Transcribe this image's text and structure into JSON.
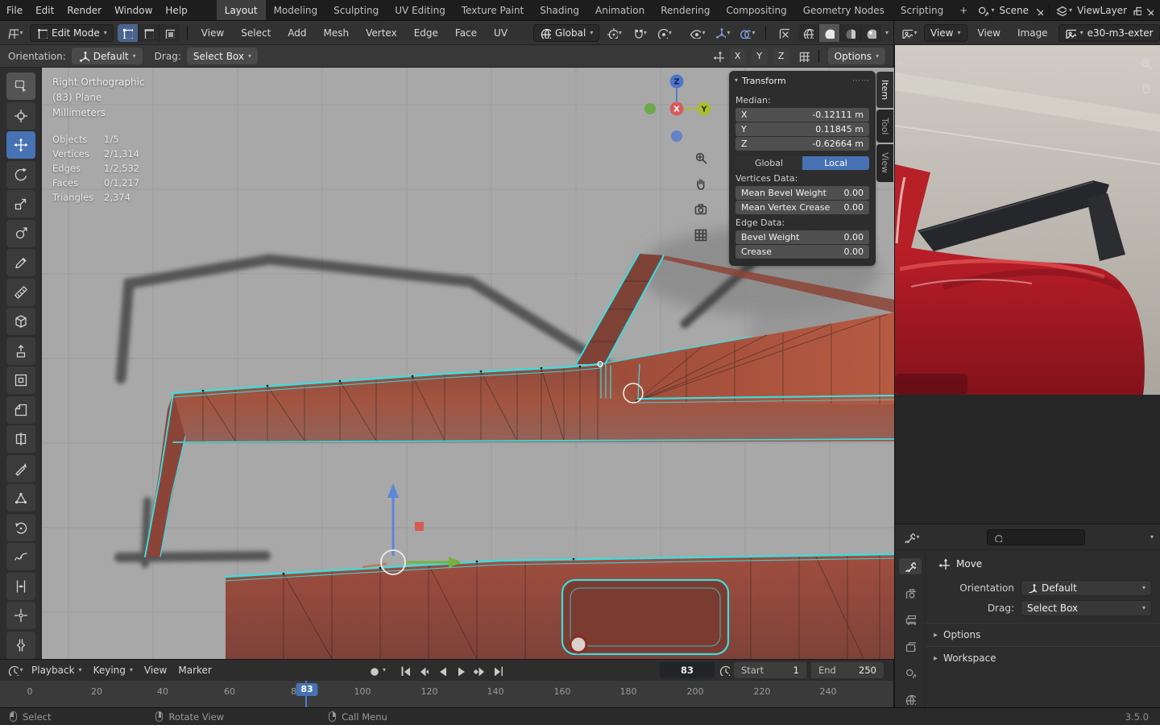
{
  "topbar": {
    "menus": [
      "File",
      "Edit",
      "Render",
      "Window",
      "Help"
    ],
    "workspaces": [
      "Layout",
      "Modeling",
      "Sculpting",
      "UV Editing",
      "Texture Paint",
      "Shading",
      "Animation",
      "Rendering",
      "Compositing",
      "Geometry Nodes",
      "Scripting"
    ],
    "active_workspace": "Layout",
    "add_workspace_label": "+",
    "scene_label": "Scene",
    "viewlayer_label": "ViewLayer"
  },
  "viewport_header": {
    "mode": "Edit Mode",
    "menus": [
      "View",
      "Select",
      "Add",
      "Mesh",
      "Vertex",
      "Edge",
      "Face",
      "UV"
    ],
    "orientation": "Global"
  },
  "img_header": {
    "view_dropdown": "View",
    "menus": [
      "View",
      "Image"
    ],
    "image_name": "e30-m3-exter"
  },
  "tool_settings": {
    "orientation_label": "Orientation:",
    "orientation_value": "Default",
    "drag_label": "Drag:",
    "drag_value": "Select Box",
    "axes": [
      "X",
      "Y",
      "Z"
    ],
    "options_label": "Options"
  },
  "viewport": {
    "view_name": "Right Orthographic",
    "object_name": "(83) Plane",
    "units": "Millimeters",
    "stats": [
      {
        "label": "Objects",
        "value": "1/5"
      },
      {
        "label": "Vertices",
        "value": "2/1,314"
      },
      {
        "label": "Edges",
        "value": "1/2,532"
      },
      {
        "label": "Faces",
        "value": "0/1,217"
      },
      {
        "label": "Triangles",
        "value": "2,374"
      }
    ],
    "gizmo": {
      "x": "X",
      "y": "Y",
      "z": "Z"
    }
  },
  "transform_panel": {
    "title": "Transform",
    "median_label": "Median:",
    "rows": [
      {
        "axis": "X",
        "value": "-0.12111 m"
      },
      {
        "axis": "Y",
        "value": "0.11845 m"
      },
      {
        "axis": "Z",
        "value": "-0.62664 m"
      }
    ],
    "space_global": "Global",
    "space_local": "Local",
    "vertices_data_label": "Vertices Data:",
    "vertex_rows": [
      {
        "label": "Mean Bevel Weight",
        "value": "0.00"
      },
      {
        "label": "Mean Vertex Crease",
        "value": "0.00"
      }
    ],
    "edge_data_label": "Edge Data:",
    "edge_rows": [
      {
        "label": "Bevel Weight",
        "value": "0.00"
      },
      {
        "label": "Crease",
        "value": "0.00"
      }
    ],
    "tabs": [
      "Item",
      "Tool",
      "View"
    ]
  },
  "props": {
    "tool_name": "Move",
    "orientation_label": "Orientation",
    "orientation_value": "Default",
    "drag_label": "Drag:",
    "drag_value": "Select Box",
    "sections": [
      "Options",
      "Workspace"
    ]
  },
  "timeline": {
    "menus": [
      "Playback",
      "Keying",
      "View",
      "Marker"
    ],
    "frame_field": "83",
    "current_frame": "83",
    "start_label": "Start",
    "start_value": "1",
    "end_label": "End",
    "end_value": "250",
    "ticks": [
      "0",
      "20",
      "40",
      "60",
      "80",
      "100",
      "120",
      "140",
      "160",
      "180",
      "200",
      "220",
      "240"
    ]
  },
  "statusbar": {
    "hints": [
      "Select",
      "Rotate View",
      "Call Menu"
    ],
    "version": "3.5.0"
  },
  "icons": {
    "left_toolbar": [
      "select-box",
      "cursor",
      "move",
      "rotate",
      "scale",
      "transform",
      "annotate",
      "measure",
      "add-cube",
      "extrude-region",
      "inset-faces",
      "bevel",
      "loop-cut",
      "knife",
      "poly-build",
      "spin",
      "smooth",
      "edge-slide",
      "shrink-fatten",
      "rip-region"
    ],
    "select_modes": [
      "vertex-select",
      "edge-select",
      "face-select"
    ],
    "shading_modes": [
      "wireframe",
      "solid",
      "material-preview",
      "rendered"
    ],
    "transport": [
      "jump-to-start",
      "previous-keyframe",
      "play-reverse",
      "play",
      "next-keyframe",
      "jump-to-end"
    ],
    "props_tabs": [
      "active-tool",
      "render",
      "output",
      "view-layer",
      "scene",
      "world"
    ]
  },
  "colors": {
    "accent_blue": "#4772b3",
    "selection_cyan": "#3adde0",
    "mesh_red": "#a0503e",
    "viewport_grey": "#a8a8a8"
  }
}
